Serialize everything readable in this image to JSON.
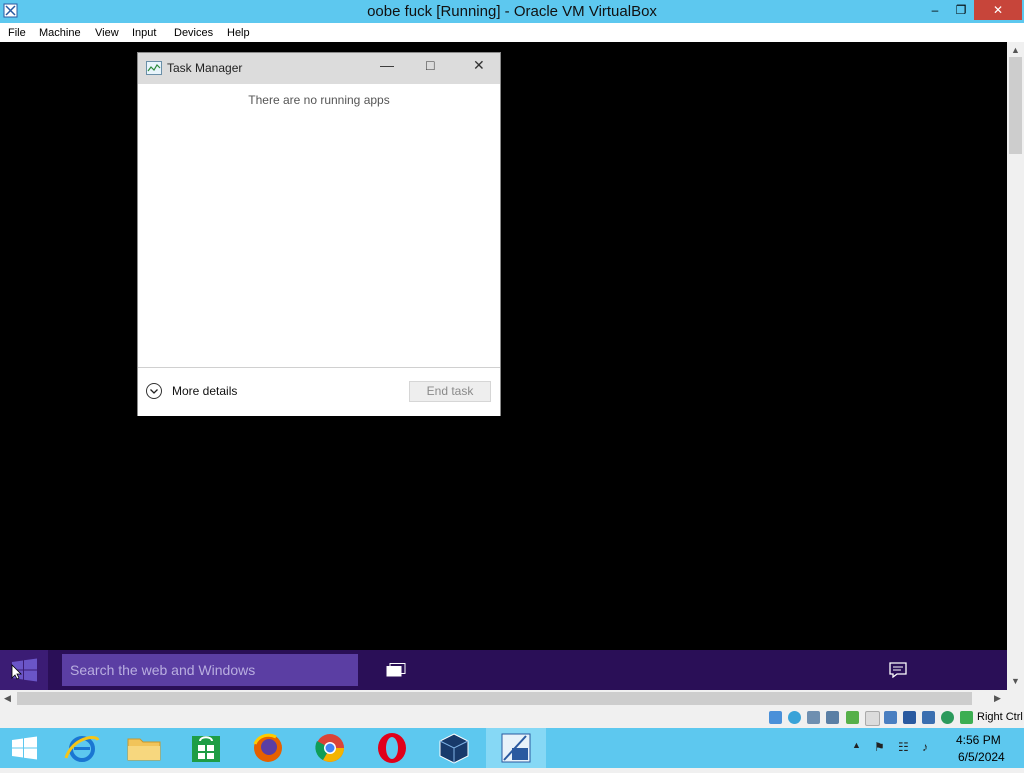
{
  "window": {
    "title": "oobe fuck [Running] - Oracle VM VirtualBox"
  },
  "menubar": {
    "items": [
      "File",
      "Machine",
      "View",
      "Input",
      "Devices",
      "Help"
    ]
  },
  "task_manager": {
    "title": "Task Manager",
    "message": "There are no running apps",
    "more_details": "More details",
    "end_task": "End task"
  },
  "guest_taskbar": {
    "search_placeholder": "Search the web and Windows"
  },
  "statusbar": {
    "host_key": "Right Ctrl"
  },
  "host_taskbar": {
    "items": [
      "start-icon",
      "internet-explorer-icon",
      "file-explorer-icon",
      "store-icon",
      "firefox-icon",
      "chrome-icon",
      "opera-icon",
      "virtualbox-icon",
      "windows10-vm-icon"
    ],
    "time": "4:56 PM",
    "date": "6/5/2024"
  },
  "colors": {
    "host_chrome": "#5dc8ef",
    "guest_taskbar": "#2a0f57",
    "search_box": "#5b3ea3"
  }
}
